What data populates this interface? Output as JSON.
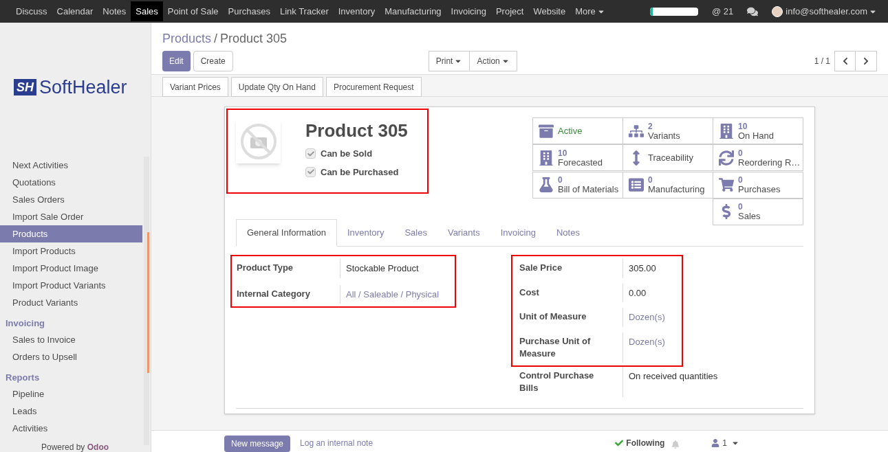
{
  "top_menu": {
    "items": [
      {
        "label": "Discuss",
        "selected": false
      },
      {
        "label": "Calendar",
        "selected": false
      },
      {
        "label": "Notes",
        "selected": false
      },
      {
        "label": "Sales",
        "selected": true
      },
      {
        "label": "Point of Sale",
        "selected": false
      },
      {
        "label": "Purchases",
        "selected": false
      },
      {
        "label": "Link Tracker",
        "selected": false
      },
      {
        "label": "Inventory",
        "selected": false
      },
      {
        "label": "Manufacturing",
        "selected": false
      },
      {
        "label": "Invoicing",
        "selected": false
      },
      {
        "label": "Project",
        "selected": false
      },
      {
        "label": "Website",
        "selected": false
      }
    ],
    "more": "More",
    "progress": {
      "level": 0.06
    },
    "mentions": "@ 21",
    "user": "info@softhealer.com"
  },
  "sidebar": {
    "logo": {
      "mark": "SH",
      "name": "SoftHealer"
    },
    "items": [
      {
        "kind": "item",
        "label": "Next Activities",
        "selected": false
      },
      {
        "kind": "item",
        "label": "Quotations",
        "selected": false
      },
      {
        "kind": "item",
        "label": "Sales Orders",
        "selected": false
      },
      {
        "kind": "item",
        "label": "Import Sale Order",
        "selected": false
      },
      {
        "kind": "item",
        "label": "Products",
        "selected": true
      },
      {
        "kind": "item",
        "label": "Import Products",
        "selected": false
      },
      {
        "kind": "item",
        "label": "Import Product Image",
        "selected": false
      },
      {
        "kind": "item",
        "label": "Import Product Variants",
        "selected": false
      },
      {
        "kind": "item",
        "label": "Product Variants",
        "selected": false
      },
      {
        "kind": "section",
        "label": "Invoicing"
      },
      {
        "kind": "item",
        "label": "Sales to Invoice",
        "selected": false
      },
      {
        "kind": "item",
        "label": "Orders to Upsell",
        "selected": false
      },
      {
        "kind": "section",
        "label": "Reports"
      },
      {
        "kind": "item",
        "label": "Pipeline",
        "selected": false
      },
      {
        "kind": "item",
        "label": "Leads",
        "selected": false
      },
      {
        "kind": "item",
        "label": "Activities",
        "selected": false
      }
    ],
    "footer": {
      "text": "Powered by",
      "brand": "Odoo"
    }
  },
  "breadcrumb": {
    "items": [
      "Products",
      "Product 305"
    ],
    "separator": "/"
  },
  "actions": {
    "edit": "Edit",
    "create": "Create",
    "print": "Print",
    "action": "Action",
    "pager": "1 / 1"
  },
  "header_buttons": [
    "Variant Prices",
    "Update Qty On Hand",
    "Procurement Request"
  ],
  "product": {
    "highlighted": true,
    "name": "Product 305",
    "options": [
      {
        "label": "Can be Sold",
        "checked": true
      },
      {
        "label": "Can be Purchased",
        "checked": true
      }
    ]
  },
  "smart_buttons": [
    {
      "kind": "toggle",
      "label": "Active",
      "active": true
    },
    {
      "kind": "stat",
      "value": "2",
      "label": "Variants"
    },
    {
      "kind": "stat",
      "value": "10",
      "label": "On Hand"
    },
    {
      "kind": "stat",
      "value": "10",
      "label": "Forecasted"
    },
    {
      "kind": "plain",
      "label": "Traceability"
    },
    {
      "kind": "stat",
      "value": "0",
      "label": "Reordering R…"
    },
    {
      "kind": "stat",
      "value": "0",
      "label": "Bill of Materials"
    },
    {
      "kind": "stat",
      "value": "0",
      "label": "Manufacturing"
    },
    {
      "kind": "stat",
      "value": "0",
      "label": "Purchases"
    },
    {
      "kind": "stat",
      "value": "0",
      "label": "Sales"
    }
  ],
  "tabs": [
    {
      "label": "General Information",
      "selected": true
    },
    {
      "label": "Inventory",
      "selected": false
    },
    {
      "label": "Sales",
      "selected": false
    },
    {
      "label": "Variants",
      "selected": false
    },
    {
      "label": "Invoicing",
      "selected": false
    },
    {
      "label": "Notes",
      "selected": false
    }
  ],
  "left_fields": {
    "highlighted": true,
    "fields": [
      {
        "label": "Product Type",
        "value": "Stockable Product",
        "kind": "text"
      },
      {
        "label": "Internal Category",
        "value": "All / Saleable / Physical",
        "kind": "link"
      }
    ]
  },
  "right_fields": {
    "highlighted": true,
    "fields": [
      {
        "label": "Sale Price",
        "value": "305.00",
        "kind": "text"
      },
      {
        "label": "Cost",
        "value": "0.00",
        "kind": "text"
      },
      {
        "label": "Unit of Measure",
        "value": "Dozen(s)",
        "kind": "link"
      },
      {
        "label": "Purchase Unit of Measure",
        "value": "Dozen(s)",
        "kind": "link"
      }
    ]
  },
  "right_more_fields": [
    {
      "label": "Control Purchase Bills",
      "value": "On received quantities",
      "kind": "text"
    }
  ],
  "chatter": {
    "new_message": "New message",
    "log_note": "Log an internal note",
    "following": "Following",
    "followers": "1"
  }
}
